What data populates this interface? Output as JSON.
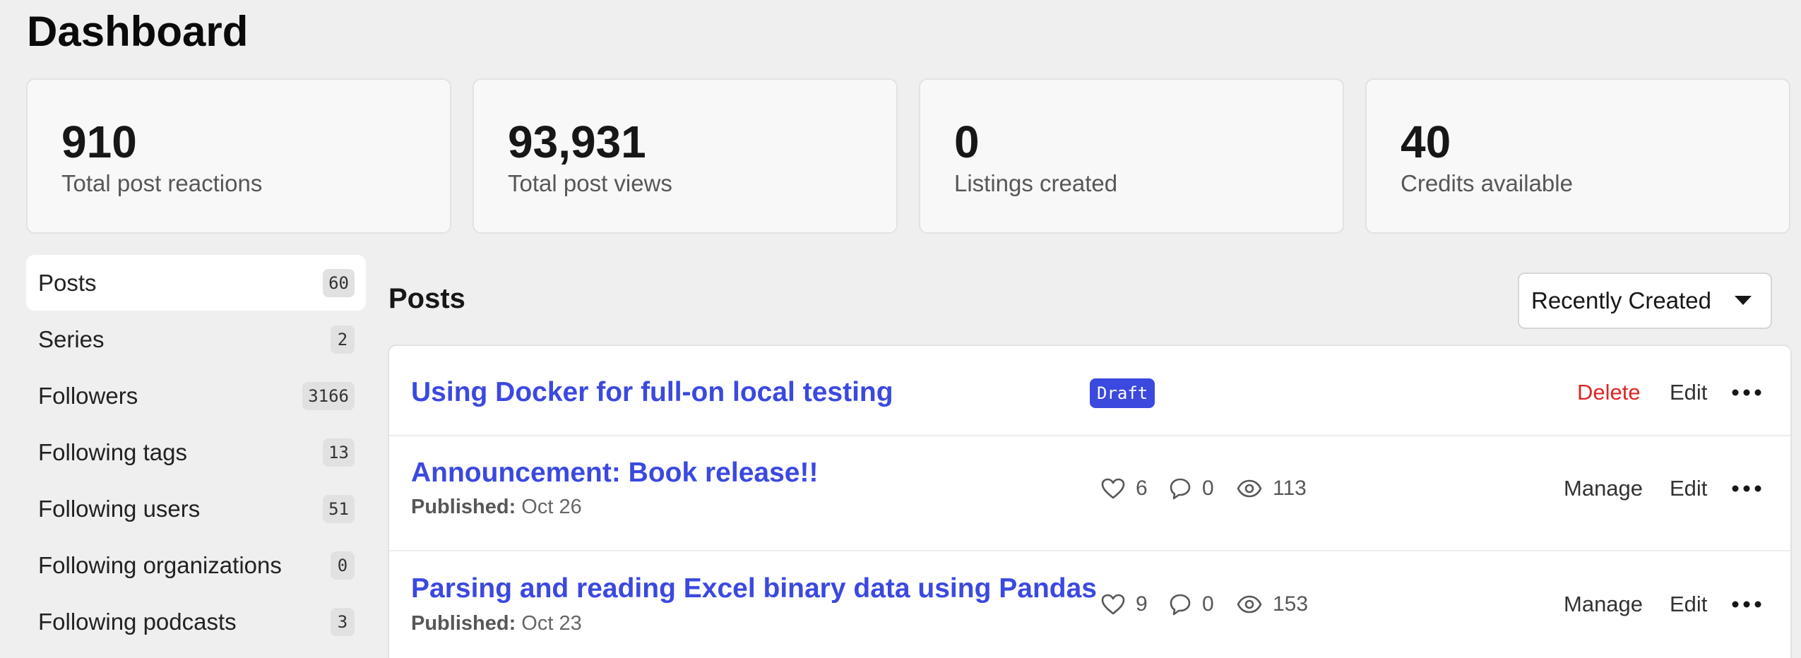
{
  "page": {
    "title": "Dashboard"
  },
  "stats": [
    {
      "value": "910",
      "label": "Total post reactions"
    },
    {
      "value": "93,931",
      "label": "Total post views"
    },
    {
      "value": "0",
      "label": "Listings created"
    },
    {
      "value": "40",
      "label": "Credits available"
    }
  ],
  "sidebar": {
    "items": [
      {
        "label": "Posts",
        "count": "60",
        "active": true
      },
      {
        "label": "Series",
        "count": "2"
      },
      {
        "label": "Followers",
        "count": "3166"
      },
      {
        "label": "Following tags",
        "count": "13"
      },
      {
        "label": "Following users",
        "count": "51"
      },
      {
        "label": "Following organizations",
        "count": "0"
      },
      {
        "label": "Following podcasts",
        "count": "3"
      }
    ]
  },
  "posts": {
    "heading": "Posts",
    "sort": {
      "selected": "Recently Created",
      "icon": "caret-down-icon"
    },
    "items": [
      {
        "title": "Using Docker for full-on local testing",
        "badge": "Draft",
        "actions": {
          "primary": "Delete",
          "edit": "Edit"
        }
      },
      {
        "title": "Announcement: Book release!!",
        "published_label": "Published:",
        "published_date": "Oct 26",
        "reactions": "6",
        "comments": "0",
        "views": "113",
        "actions": {
          "primary": "Manage",
          "edit": "Edit"
        }
      },
      {
        "title": "Parsing and reading Excel binary data using Pandas",
        "published_label": "Published:",
        "published_date": "Oct 23",
        "reactions": "9",
        "comments": "0",
        "views": "153",
        "actions": {
          "primary": "Manage",
          "edit": "Edit"
        }
      }
    ]
  },
  "colors": {
    "accent": "#3b49df",
    "danger": "#dc2626",
    "background": "#efefef"
  }
}
